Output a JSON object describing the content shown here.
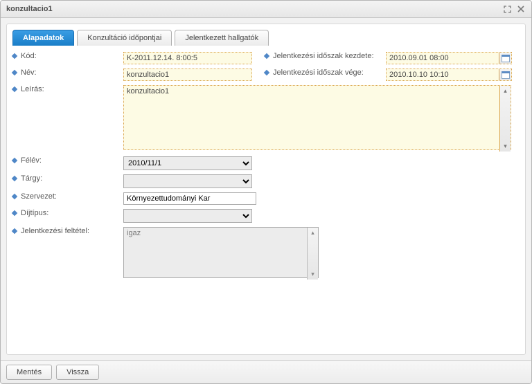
{
  "window": {
    "title": "konzultacio1"
  },
  "tabs": [
    {
      "label": "Alapadatok",
      "active": true
    },
    {
      "label": "Konzultáció időpontjai",
      "active": false
    },
    {
      "label": "Jelentkezett hallgatók",
      "active": false
    }
  ],
  "labels": {
    "kod": "Kód:",
    "nev": "Név:",
    "leiras": "Leírás:",
    "jel_kezdete": "Jelentkezési időszak kezdete:",
    "jel_vege": "Jelentkezési időszak vége:",
    "felev": "Félév:",
    "targy": "Tárgy:",
    "szervezet": "Szervezet:",
    "dijtipus": "Díjtípus:",
    "jel_feltetel": "Jelentkezési feltétel:"
  },
  "values": {
    "kod": "K-2011.12.14. 8:00:5",
    "nev": "konzultacio1",
    "leiras": "konzultacio1",
    "jel_kezdete": "2010.09.01 08:00",
    "jel_vege": "2010.10.10 10:10",
    "felev_selected": "2010/11/1",
    "targy_selected": "",
    "szervezet": "Környezettudományi Kar",
    "dijtipus_selected": "",
    "jel_feltetel": "igaz"
  },
  "options": {
    "felev": [
      "2010/11/1"
    ],
    "targy": [
      ""
    ],
    "dijtipus": [
      ""
    ]
  },
  "footer": {
    "save": "Mentés",
    "back": "Vissza"
  }
}
